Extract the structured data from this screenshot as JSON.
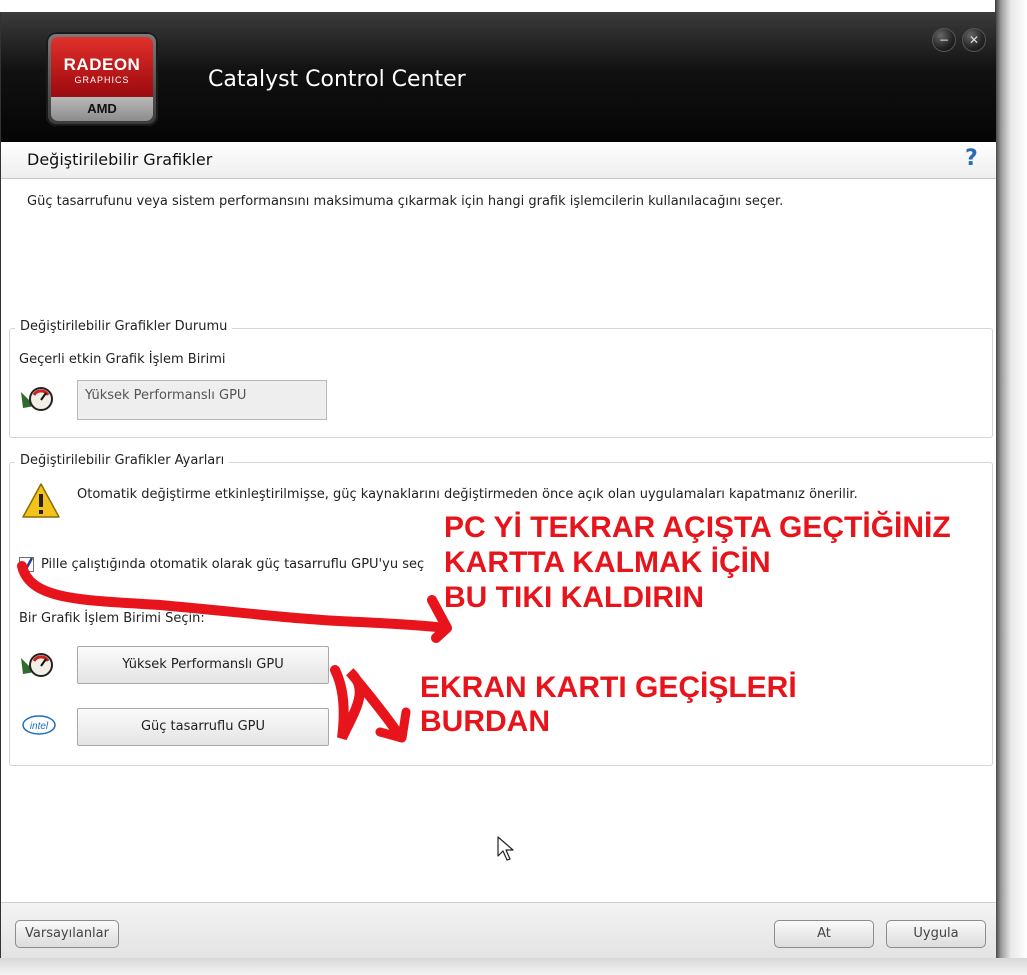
{
  "window": {
    "app_title": "Catalyst Control Center",
    "logo": {
      "line1": "RADEON",
      "line2": "GRAPHICS",
      "brand": "AMD"
    },
    "minimize_icon": "minimize-icon",
    "close_icon": "close-icon"
  },
  "page": {
    "title": "Değiştirilebilir Grafikler",
    "help": "?",
    "description": "Güç tasarrufunu veya sistem performansını maksimuma çıkarmak için hangi grafik işlemcilerin kullanılacağını seçer."
  },
  "status_group": {
    "legend": "Değiştirilebilir Grafikler Durumu",
    "current_label": "Geçerli etkin Grafik İşlem Birimi",
    "current_value": "Yüksek Performanslı GPU"
  },
  "settings_group": {
    "legend": "Değiştirilebilir Grafikler Ayarları",
    "warning": "Otomatik değiştirme etkinleştirilmişse, güç kaynaklarını değiştirmeden önce açık olan uygulamaları kapatmanız önerilir.",
    "auto_switch_label": "Pille çalıştığında otomatik olarak güç tasarruflu GPU'yu seç",
    "auto_switch_checked": true,
    "select_label": "Bir Grafik İşlem Birimi Seçin:",
    "high_perf_button": "Yüksek Performanslı GPU",
    "power_saving_button": "Güç tasarruflu GPU",
    "intel_logo": "intel"
  },
  "footer": {
    "defaults": "Varsayılanlar",
    "discard": "At",
    "apply": "Uygula"
  },
  "annotations": {
    "note1_line1": "PC Yİ TEKRAR AÇIŞTA GEÇTİĞİNİZ",
    "note1_line2": "KARTTA KALMAK İÇİN",
    "note1_line3": "BU TIKI KALDIRIN",
    "note2_line1": "EKRAN KARTI GEÇİŞLERİ",
    "note2_line2": "BURDAN",
    "color": "#e8141c"
  }
}
